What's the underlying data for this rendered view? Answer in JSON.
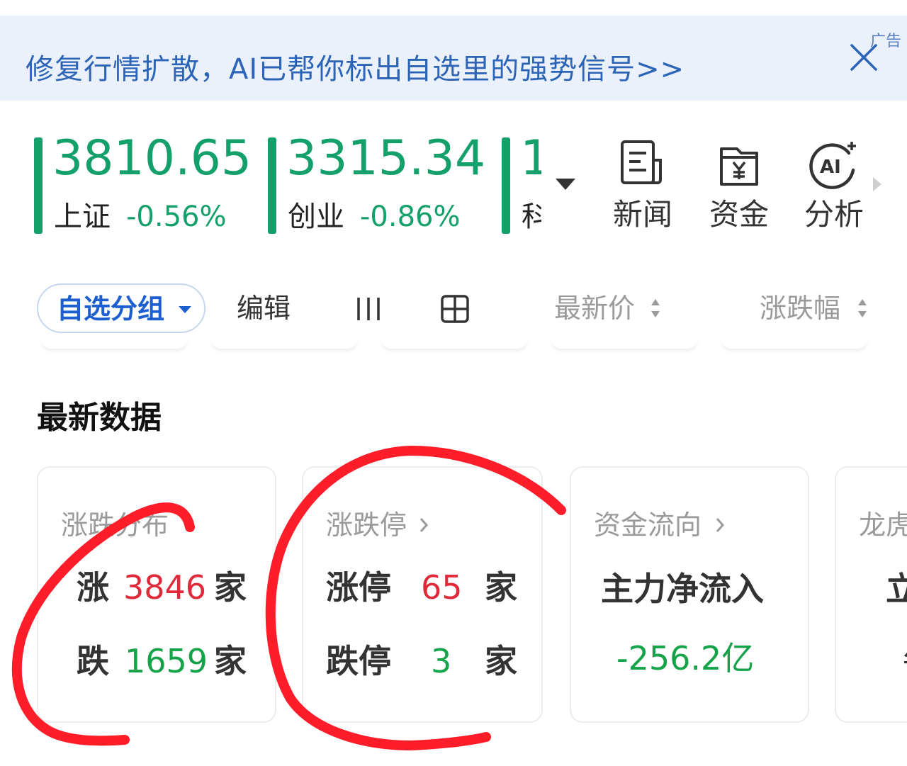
{
  "ad": {
    "text": "修复行情扩散，AI已帮你标出自选里的强势信号>>",
    "badge": "广告"
  },
  "indices": [
    {
      "value": "3810.65",
      "name": "上证",
      "change": "-0.56%"
    },
    {
      "value": "3315.34",
      "name": "创业",
      "change": "-0.86%"
    },
    {
      "value": "1",
      "name": "科",
      "change": ""
    }
  ],
  "tools": [
    {
      "label": "新闻",
      "icon": "news-icon"
    },
    {
      "label": "资金",
      "icon": "fund-icon"
    },
    {
      "label": "分析",
      "icon": "ai-analysis-icon"
    }
  ],
  "toolbar": {
    "group_label": "自选分组",
    "edit_label": "编辑",
    "sort_price": "最新价",
    "sort_change": "涨跌幅"
  },
  "section": {
    "title": "最新数据"
  },
  "cards": {
    "distribution": {
      "title": "涨跌分布",
      "up_label": "涨",
      "up_count": "3846",
      "up_unit": "家",
      "down_label": "跌",
      "down_count": "1659",
      "down_unit": "家"
    },
    "limit": {
      "title": "涨跌停",
      "up_label": "涨停",
      "up_count": "65",
      "up_unit": "家",
      "down_label": "跌停",
      "down_count": "3",
      "down_unit": "家"
    },
    "flow": {
      "title": "资金流向",
      "label": "主力净流入",
      "value": "-256.2亿"
    },
    "dragon": {
      "title": "龙虎",
      "line1": "立",
      "line2": "每"
    }
  },
  "colors": {
    "up_red": "#e02a3a",
    "down_green": "#14a348",
    "index_green": "#14a06a",
    "accent_blue": "#1d5fd1",
    "annotation_red": "#ff1d2a"
  }
}
